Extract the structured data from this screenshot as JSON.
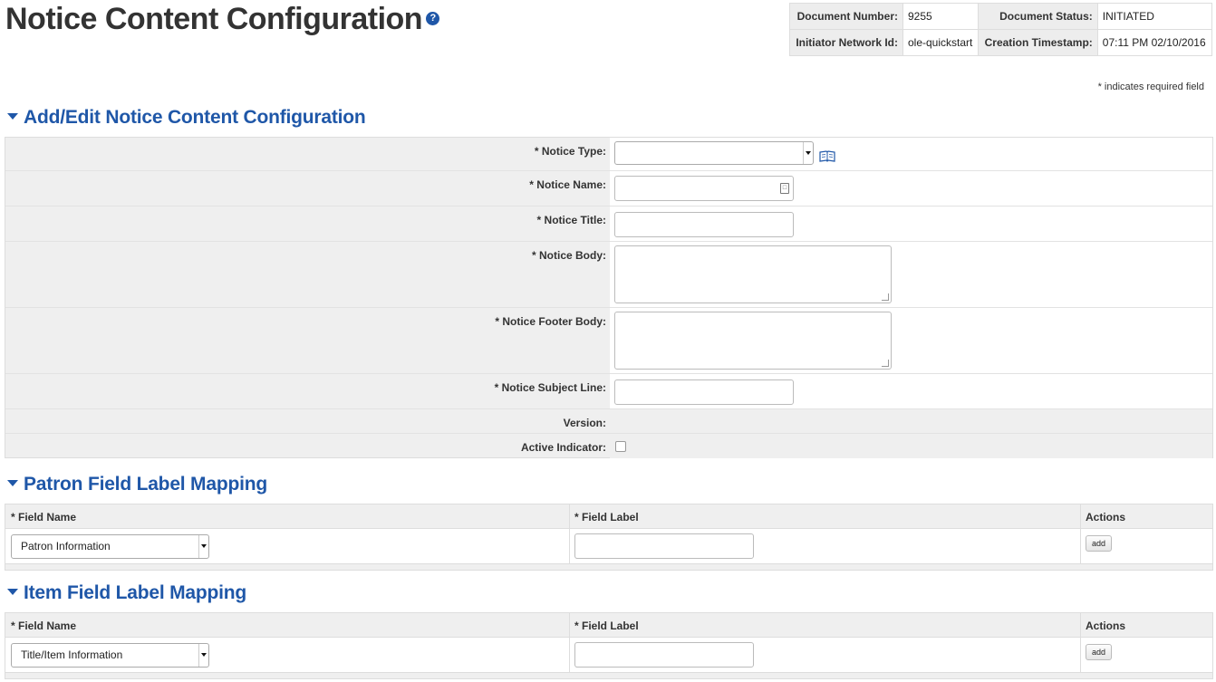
{
  "page": {
    "title": "Notice Content Configuration",
    "help_icon": "question-circle-icon"
  },
  "document": {
    "number_label": "Document Number:",
    "number": "9255",
    "status_label": "Document Status:",
    "status": "INITIATED",
    "initiator_label": "Initiator Network Id:",
    "initiator": "ole-quickstart",
    "created_label": "Creation Timestamp:",
    "created": "07:11 PM 02/10/2016"
  },
  "required_note": "* indicates required field",
  "edit_section": {
    "title": "Add/Edit Notice Content Configuration",
    "fields": {
      "notice_type": {
        "label": "* Notice Type:",
        "value": ""
      },
      "notice_name": {
        "label": "* Notice Name:",
        "value": ""
      },
      "notice_title": {
        "label": "* Notice Title:",
        "value": ""
      },
      "notice_body": {
        "label": "* Notice Body:",
        "value": ""
      },
      "notice_footer_body": {
        "label": "* Notice Footer Body:",
        "value": ""
      },
      "notice_subject_line": {
        "label": "* Notice Subject Line:",
        "value": ""
      },
      "version": {
        "label": "Version:",
        "value": ""
      },
      "active_indicator": {
        "label": "Active Indicator:",
        "checked": false
      }
    }
  },
  "patron_section": {
    "title": "Patron Field Label Mapping",
    "col_field_name": "* Field Name",
    "col_field_label": "* Field Label",
    "col_actions": "Actions",
    "field_name_value": "Patron Information",
    "field_label_value": "",
    "add_label": "add"
  },
  "item_section": {
    "title": "Item Field Label Mapping",
    "col_field_name": "* Field Name",
    "col_field_label": "* Field Label",
    "col_actions": "Actions",
    "field_name_value": "Title/Item Information",
    "field_label_value": "",
    "add_label": "add"
  },
  "colors": {
    "section_blue": "#1f57a8",
    "panel_gray": "#efefef",
    "border": "#dddddd"
  }
}
